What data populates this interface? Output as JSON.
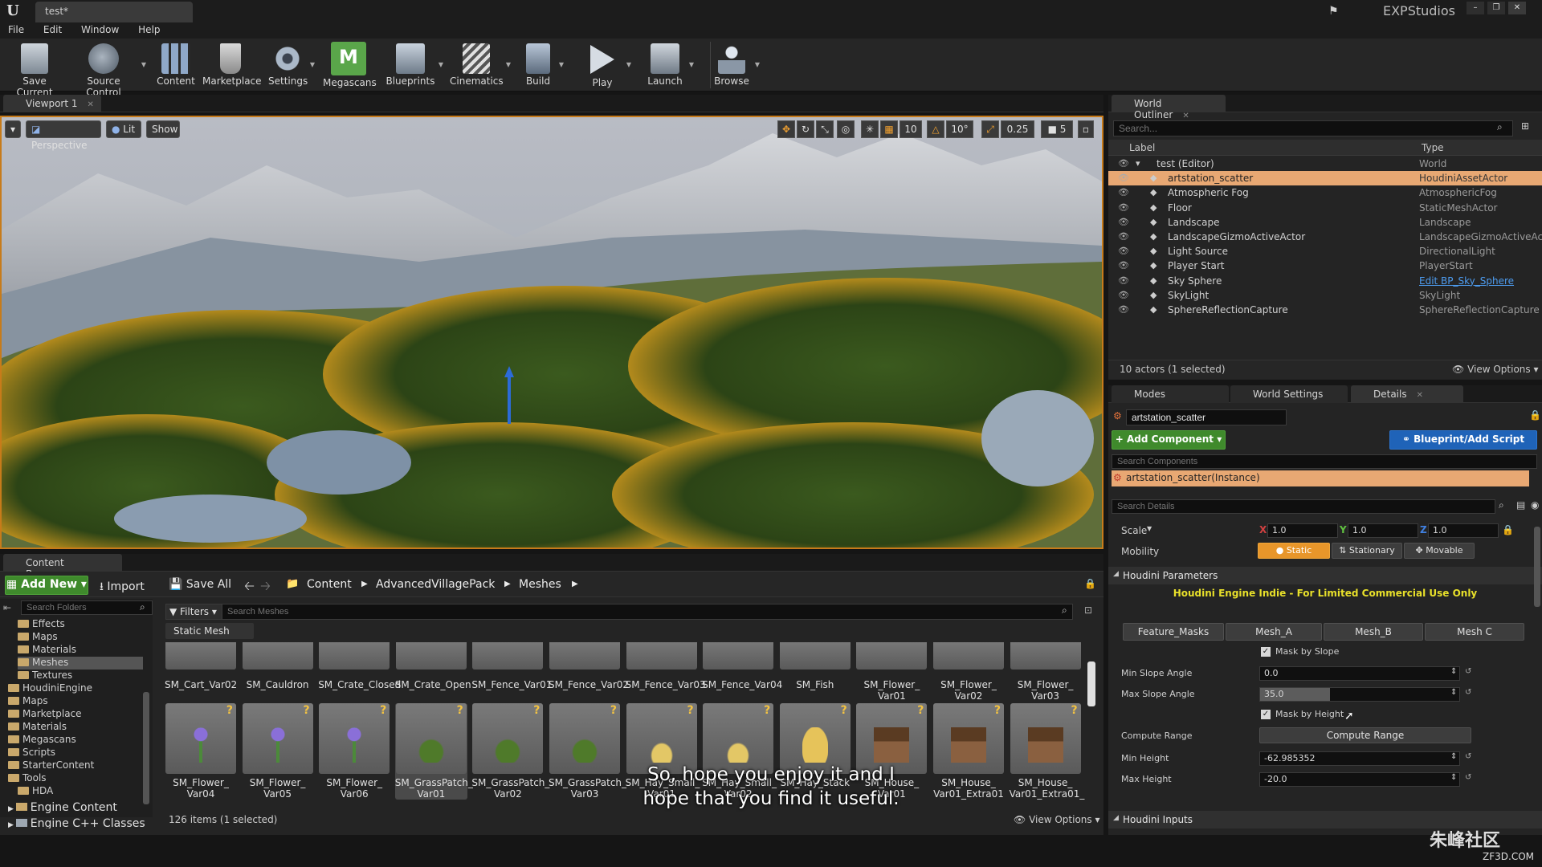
{
  "app": {
    "doc_tab": "test*",
    "studio": "EXPStudios"
  },
  "menu": [
    "File",
    "Edit",
    "Window",
    "Help"
  ],
  "toolbar": [
    {
      "label": "Save Current",
      "icon": "save-icon"
    },
    {
      "label": "Source Control",
      "icon": "source-control-icon"
    },
    {
      "label": "Content",
      "icon": "content-icon"
    },
    {
      "label": "Marketplace",
      "icon": "marketplace-icon"
    },
    {
      "label": "Settings",
      "icon": "settings-icon"
    },
    {
      "label": "Megascans",
      "icon": "megascans-icon"
    },
    {
      "label": "Blueprints",
      "icon": "blueprints-icon"
    },
    {
      "label": "Cinematics",
      "icon": "cinematics-icon"
    },
    {
      "label": "Build",
      "icon": "build-icon"
    },
    {
      "label": "Play",
      "icon": "play-icon"
    },
    {
      "label": "Launch",
      "icon": "launch-icon"
    },
    {
      "label": "Browse",
      "icon": "browse-icon"
    }
  ],
  "viewport": {
    "tab": "Viewport 1",
    "perspective": "Perspective",
    "lit": "Lit",
    "show": "Show",
    "grid_snap": "10",
    "rot_snap": "10°",
    "scale_snap": "0.25",
    "camera_speed": "5"
  },
  "outliner": {
    "tab": "World Outliner",
    "search_placeholder": "Search...",
    "col_label": "Label",
    "col_type": "Type",
    "rows": [
      {
        "label": "test (Editor)",
        "type": "World"
      },
      {
        "label": "artstation_scatter",
        "type": "HoudiniAssetActor"
      },
      {
        "label": "Atmospheric Fog",
        "type": "AtmosphericFog"
      },
      {
        "label": "Floor",
        "type": "StaticMeshActor"
      },
      {
        "label": "Landscape",
        "type": "Landscape"
      },
      {
        "label": "LandscapeGizmoActiveActor",
        "type": "LandscapeGizmoActiveAct"
      },
      {
        "label": "Light Source",
        "type": "DirectionalLight"
      },
      {
        "label": "Player Start",
        "type": "PlayerStart"
      },
      {
        "label": "Sky Sphere",
        "type": "Edit BP_Sky_Sphere"
      },
      {
        "label": "SkyLight",
        "type": "SkyLight"
      },
      {
        "label": "SphereReflectionCapture",
        "type": "SphereReflectionCapture"
      }
    ],
    "status": "10 actors (1 selected)",
    "view_options": "View Options"
  },
  "details": {
    "tabs": [
      "Modes",
      "World Settings",
      "Details"
    ],
    "actor_name": "artstation_scatter",
    "add_component": "+ Add Component",
    "blueprint": "Blueprint/Add Script",
    "search_components": "Search Components",
    "component": "artstation_scatter(Instance)",
    "search_details": "Search Details",
    "scale_label": "Scale",
    "scale": {
      "x": "1.0",
      "y": "1.0",
      "z": "1.0"
    },
    "mobility_label": "Mobility",
    "mobility": [
      "Static",
      "Stationary",
      "Movable"
    ],
    "houdini_params": "Houdini Parameters",
    "license": "Houdini Engine Indie - For Limited Commercial Use Only",
    "param_tabs": [
      "Feature_Masks",
      "Mesh_A",
      "Mesh_B",
      "Mesh C"
    ],
    "mask_by_slope": "Mask by Slope",
    "min_slope_label": "Min Slope Angle",
    "min_slope": "0.0",
    "max_slope_label": "Max Slope Angle",
    "max_slope": "35.0",
    "max_slope_fraction": 0.35,
    "mask_by_height": "Mask by Height",
    "compute_range_label": "Compute Range",
    "compute_range_btn": "Compute Range",
    "min_height_label": "Min Height",
    "min_height": "-62.985352",
    "max_height_label": "Max Height",
    "max_height": "-20.0",
    "houdini_inputs": "Houdini Inputs"
  },
  "content_browser": {
    "tab": "Content Browser",
    "add_new": "Add New",
    "import": "Import",
    "save_all": "Save All",
    "crumbs": [
      "Content",
      "AdvancedVillagePack",
      "Meshes"
    ],
    "search_folders": "Search Folders",
    "filters": "Filters",
    "search_meshes": "Search Meshes",
    "category": "Static Mesh",
    "folders": [
      {
        "label": "Effects",
        "depth": 2
      },
      {
        "label": "Maps",
        "depth": 2
      },
      {
        "label": "Materials",
        "depth": 2
      },
      {
        "label": "Meshes",
        "depth": 2
      },
      {
        "label": "Textures",
        "depth": 2
      },
      {
        "label": "HoudiniEngine",
        "depth": 1
      },
      {
        "label": "Maps",
        "depth": 1
      },
      {
        "label": "Marketplace",
        "depth": 1
      },
      {
        "label": "Materials",
        "depth": 1
      },
      {
        "label": "Megascans",
        "depth": 1
      },
      {
        "label": "Scripts",
        "depth": 1
      },
      {
        "label": "StarterContent",
        "depth": 1
      },
      {
        "label": "Tools",
        "depth": 1
      },
      {
        "label": "HDA",
        "depth": 2
      }
    ],
    "engine_content": "Engine Content",
    "engine_cpp": "Engine C++ Classes",
    "row1": [
      [
        "SM_Cart_Var02"
      ],
      [
        "SM_Cauldron"
      ],
      [
        "SM_Crate_Closed"
      ],
      [
        "SM_Crate_Open"
      ],
      [
        "SM_Fence_Var01"
      ],
      [
        "SM_Fence_Var02"
      ],
      [
        "SM_Fence_Var03"
      ],
      [
        "SM_Fence_Var04"
      ],
      [
        "SM_Fish"
      ],
      [
        "SM_Flower_",
        "Var01"
      ],
      [
        "SM_Flower_",
        "Var02"
      ],
      [
        "SM_Flower_",
        "Var03"
      ]
    ],
    "row2": [
      [
        "SM_Flower_",
        "Var04"
      ],
      [
        "SM_Flower_",
        "Var05"
      ],
      [
        "SM_Flower_",
        "Var06"
      ],
      [
        "SM_GrassPatch_",
        "Var01"
      ],
      [
        "SM_GrassPatch_",
        "Var02"
      ],
      [
        "SM_GrassPatch_",
        "Var03"
      ],
      [
        "SM_Hay_Small_",
        "Var01"
      ],
      [
        "SM_Hay_Small_",
        "Var02"
      ],
      [
        "SM_Hay_Stack",
        ""
      ],
      [
        "SM_House_",
        "Var01"
      ],
      [
        "SM_House_",
        "Var01_Extra01"
      ],
      [
        "SM_House_",
        "Var01_Extra01_"
      ]
    ],
    "status": "126 items (1 selected)",
    "view_options": "View Options"
  },
  "subtitle": [
    "So, hope you enjoy it and I",
    "hope that you find it useful."
  ],
  "watermark": {
    "line1": "朱峰社区",
    "line2": "ZF3D.COM"
  }
}
